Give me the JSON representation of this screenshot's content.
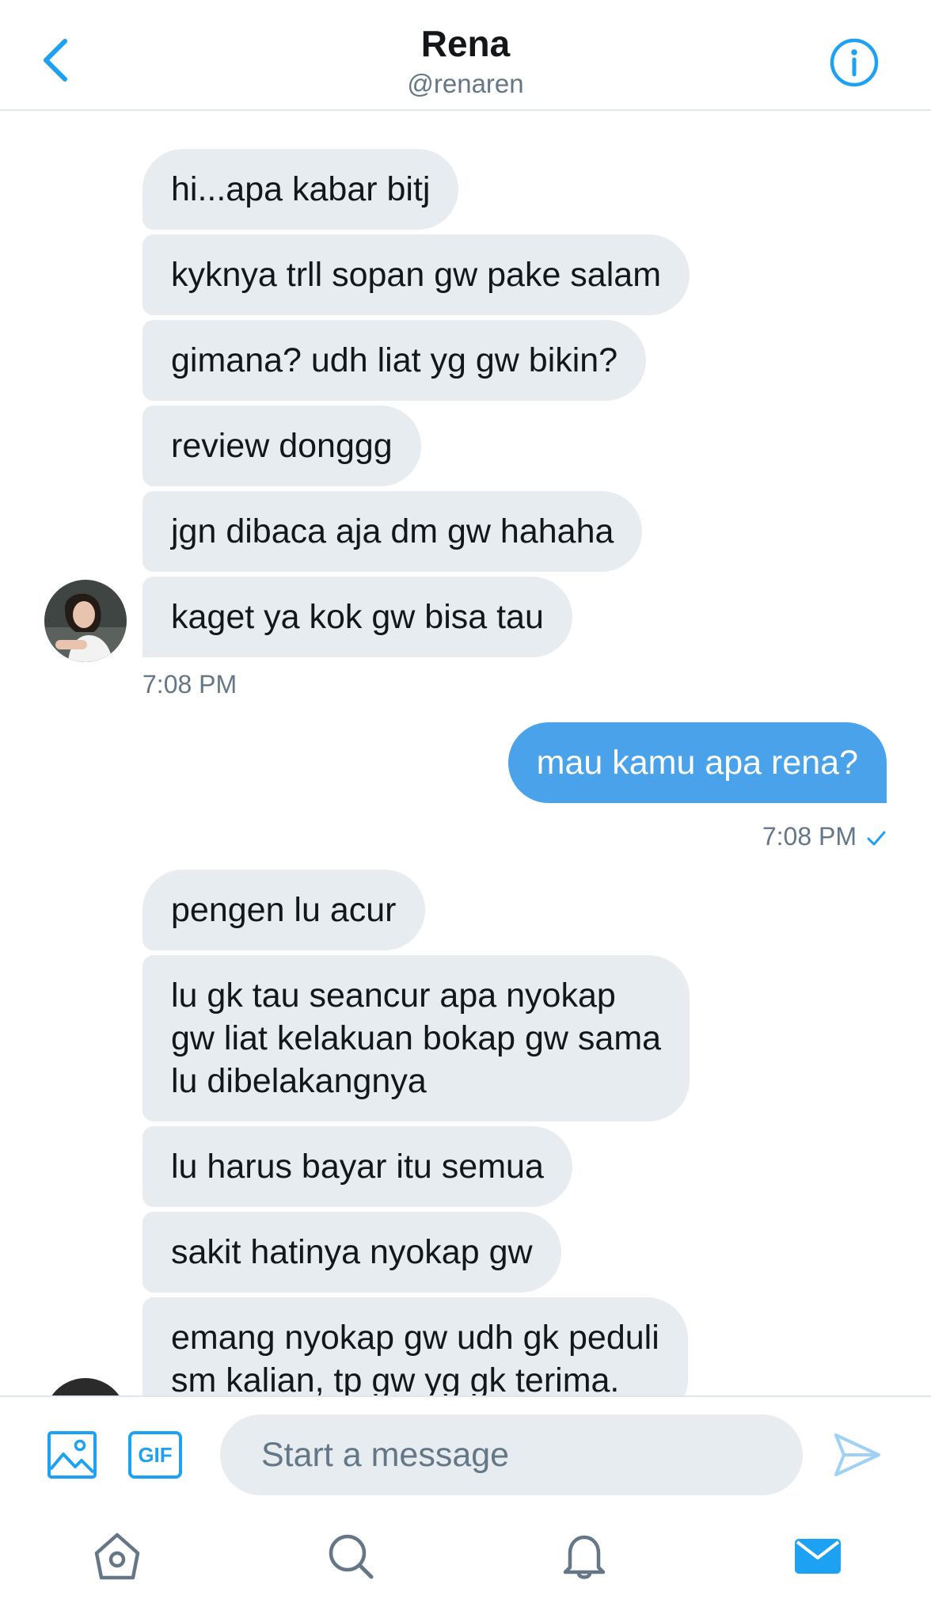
{
  "header": {
    "title": "Rena",
    "handle": "@renaren",
    "back_icon": "chevron-left-icon",
    "info_icon": "info-circle-icon"
  },
  "conversation": {
    "group1": [
      "hi...apa kabar bitj",
      "kyknya trll sopan gw pake salam",
      "gimana? udh liat yg gw bikin?",
      "review donggg",
      "jgn dibaca aja dm gw hahaha",
      "kaget ya kok gw bisa tau"
    ],
    "group1_time": "7:08 PM",
    "sent": {
      "text": "mau kamu apa rena?",
      "time": "7:08 PM",
      "status_icon": "checkmark-icon"
    },
    "group2": [
      "pengen lu acur",
      "lu gk tau seancur apa nyokap\ngw liat kelakuan bokap gw sama\nlu dibelakangnya",
      "lu harus bayar itu semua",
      "sakit hatinya nyokap gw",
      "emang nyokap gw udh gk peduli\nsm kalian, tp gw yg gk terima."
    ]
  },
  "composer": {
    "placeholder": "Start a message",
    "image_icon": "image-icon",
    "gif_label": "GIF",
    "send_icon": "send-icon"
  },
  "tabbar": {
    "items": [
      "home-icon",
      "search-icon",
      "notifications-icon",
      "messages-icon"
    ]
  },
  "colors": {
    "accent": "#1da1f2",
    "sent_bubble": "#4aa3ea",
    "received_bubble": "#e6ecf0",
    "secondary_text": "#657786"
  }
}
